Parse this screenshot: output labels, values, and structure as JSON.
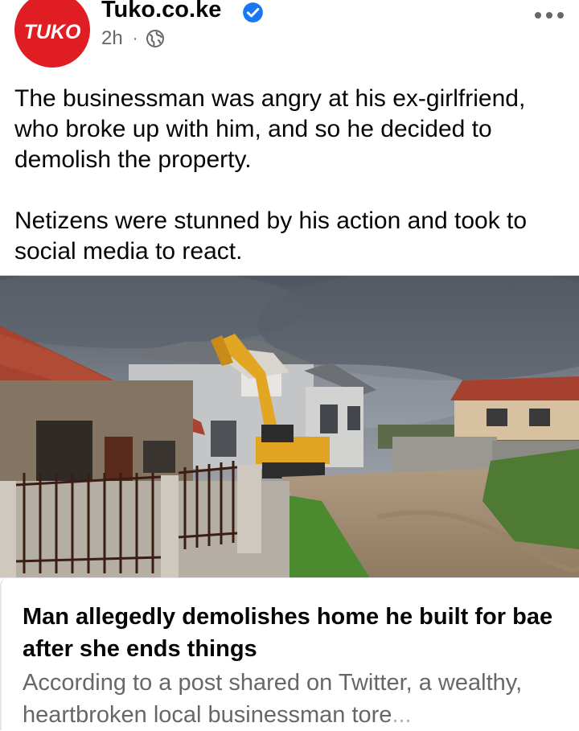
{
  "post": {
    "avatar_text": "TUKO",
    "page_name": "Tuko.co.ke",
    "time": "2h",
    "separator": "·",
    "text_paragraphs": [
      "The businessman was angry at his ex-girlfriend, who broke up with him, and so he decided to demolish the property.",
      "Netizens were stunned by his action and took to social media to react."
    ]
  },
  "link_preview": {
    "title": "Man allegedly demolishes home he built for bae after she ends things",
    "description": "According to a post shared on Twitter, a wealthy, heartbroken local businessman tore",
    "ellipsis": "..."
  },
  "colors": {
    "brand_red": "#e11d24",
    "verified_blue": "#1877f2",
    "secondary_text": "#65676b"
  },
  "icons": {
    "verified": "verified-badge-icon",
    "audience": "globe-icon",
    "menu": "more-options-icon"
  }
}
